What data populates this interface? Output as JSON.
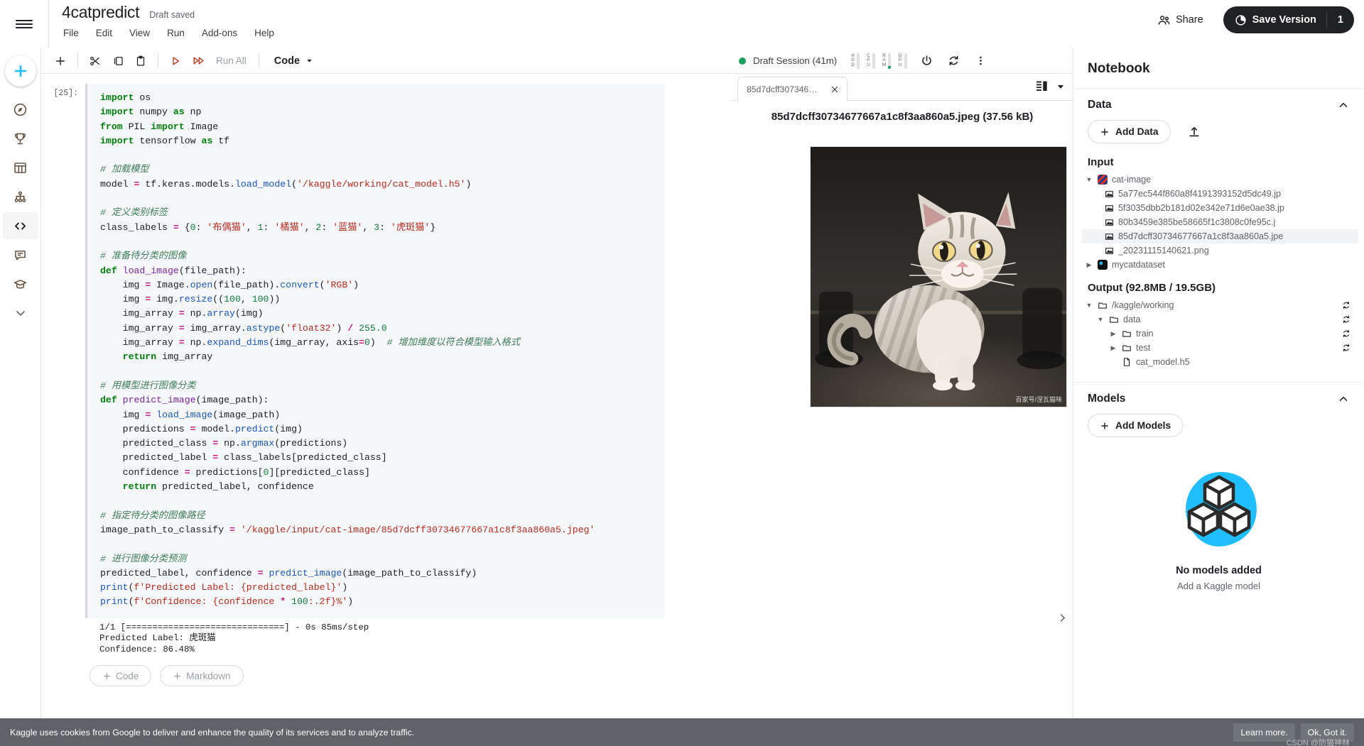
{
  "header": {
    "notebook_title": "4catpredict",
    "draft_status": "Draft saved",
    "menus": [
      "File",
      "Edit",
      "View",
      "Run",
      "Add-ons",
      "Help"
    ],
    "share_label": "Share",
    "save_version_label": "Save Version",
    "version_count": "1"
  },
  "rail": {
    "items": [
      {
        "name": "create-button",
        "icon": "plus-icon"
      },
      {
        "name": "home-compass",
        "icon": "compass-icon"
      },
      {
        "name": "competitions",
        "icon": "trophy-icon"
      },
      {
        "name": "datasets",
        "icon": "table-icon"
      },
      {
        "name": "models",
        "icon": "network-icon"
      },
      {
        "name": "code",
        "icon": "code-brackets-icon"
      },
      {
        "name": "discussions",
        "icon": "comment-icon"
      },
      {
        "name": "learn",
        "icon": "graduation-cap-icon"
      },
      {
        "name": "more",
        "icon": "chevron-down-icon"
      }
    ]
  },
  "toolbar": {
    "add_label": "+",
    "cut_label": "cut",
    "copy_label": "copy",
    "paste_label": "paste",
    "run_label": "run",
    "run_all_label": "Run All",
    "cell_type": "Code"
  },
  "cell": {
    "prompt": "[25]:",
    "code_lines": [
      "import os",
      "import numpy as np",
      "from PIL import Image",
      "import tensorflow as tf",
      "",
      "# 加载模型",
      "model = tf.keras.models.load_model('/kaggle/working/cat_model.h5')",
      "",
      "# 定义类别标签",
      "class_labels = {0: '布偶猫', 1: '橘猫', 2: '蓝猫', 3: '虎斑猫'}",
      "",
      "# 准备待分类的图像",
      "def load_image(file_path):",
      "    img = Image.open(file_path).convert('RGB')",
      "    img = img.resize((100, 100))",
      "    img_array = np.array(img)",
      "    img_array = img_array.astype('float32') / 255.0",
      "    img_array = np.expand_dims(img_array, axis=0)  # 增加维度以符合模型输入格式",
      "    return img_array",
      "",
      "# 用模型进行图像分类",
      "def predict_image(image_path):",
      "    img = load_image(image_path)",
      "    predictions = model.predict(img)",
      "    predicted_class = np.argmax(predictions)",
      "    predicted_label = class_labels[predicted_class]",
      "    confidence = predictions[0][predicted_class]",
      "    return predicted_label, confidence",
      "",
      "# 指定待分类的图像路径",
      "image_path_to_classify = '/kaggle/input/cat-image/85d7dcff30734677667a1c8f3aa860a5.jpeg'",
      "",
      "# 进行图像分类预测",
      "predicted_label, confidence = predict_image(image_path_to_classify)",
      "print(f'Predicted Label: {predicted_label}')",
      "print(f'Confidence: {confidence * 100:.2f}%')"
    ],
    "output_lines": [
      "1/1 [==============================] - 0s 85ms/step",
      "Predicted Label: 虎斑猫",
      "Confidence: 86.48%"
    ],
    "add_code_label": "Code",
    "add_markdown_label": "Markdown"
  },
  "session": {
    "status_label": "Draft Session (41m)",
    "status_color": "#1aa260",
    "gauges": [
      {
        "label": "HDD",
        "fill_pct": 0
      },
      {
        "label": "CPU",
        "fill_pct": 0
      },
      {
        "label": "RAM",
        "fill_pct": 18
      },
      {
        "label": "GPU",
        "fill_pct": 0
      }
    ],
    "power_icon": "power-icon",
    "restart_icon": "restart-icon",
    "more_icon": "more-vertical-icon"
  },
  "viewer": {
    "tab_label": "85d7dcff30734677...",
    "file_heading": "85d7dcff30734677667a1c8f3aa860a5.jpeg (37.56 kB)",
    "image_watermark": "百家号/涅瓦猫咪",
    "list_icon": "list-view-icon",
    "dropdown_icon": "chevron-down-icon"
  },
  "sidebar": {
    "panel_title": "Notebook",
    "data_section": {
      "title": "Data",
      "add_data_label": "Add Data",
      "upload_icon": "upload-icon",
      "input_title": "Input",
      "datasets": [
        {
          "name": "cat-image",
          "expanded": true,
          "files": [
            {
              "name": "5a77ec544f860a8f4191393152d5dc49.jp",
              "selected": false
            },
            {
              "name": "5f3035dbb2b181d02e342e71d6e0ae38.jp",
              "selected": false
            },
            {
              "name": "80b3459e385be58665f1c3808c0fe95c.j",
              "selected": false
            },
            {
              "name": "85d7dcff30734677667a1c8f3aa860a5.jpe",
              "selected": true
            },
            {
              "name": "_20231115140621.png",
              "selected": false
            }
          ]
        },
        {
          "name": "mycatdataset",
          "expanded": false,
          "files": []
        }
      ],
      "output_title": "Output (92.8MB / 19.5GB)",
      "output_tree": [
        {
          "name": "/kaggle/working",
          "type": "folder",
          "depth": 0,
          "expanded": true,
          "refresh": true
        },
        {
          "name": "data",
          "type": "folder",
          "depth": 1,
          "expanded": true,
          "refresh": true
        },
        {
          "name": "train",
          "type": "folder",
          "depth": 2,
          "expanded": false,
          "refresh": true
        },
        {
          "name": "test",
          "type": "folder",
          "depth": 2,
          "expanded": false,
          "refresh": true
        },
        {
          "name": "cat_model.h5",
          "type": "file",
          "depth": 2,
          "expanded": false,
          "refresh": false
        }
      ]
    },
    "models_section": {
      "title": "Models",
      "add_models_label": "Add Models",
      "empty_title": "No models added",
      "empty_subtitle": "Add a Kaggle model",
      "accent_color": "#20beff"
    }
  },
  "cookie_bar": {
    "text": "Kaggle uses cookies from Google to deliver and enhance the quality of its services and to analyze traffic.",
    "learn_more_label": "Learn more.",
    "ok_label": "Ok, Got it.",
    "watermark": "CSDN @防猫神林"
  }
}
